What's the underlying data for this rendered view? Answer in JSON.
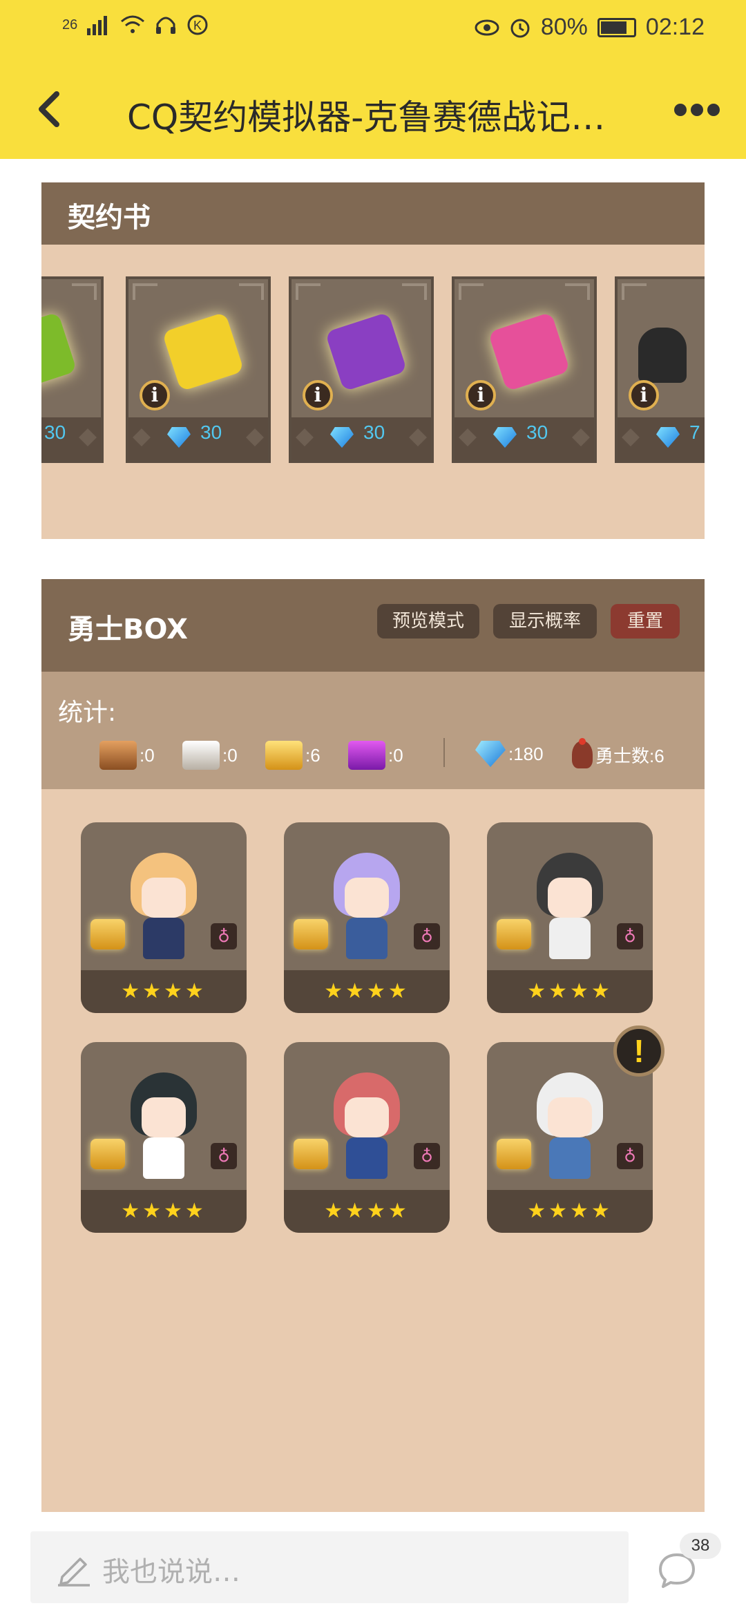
{
  "status_bar": {
    "signal": "26",
    "battery": "80%",
    "time": "02:12"
  },
  "header": {
    "title": "CQ契约模拟器-克鲁赛德战记…"
  },
  "contract_panel": {
    "title": "契约书",
    "cards": [
      {
        "scroll_color": "#7dbb2a",
        "price": "30"
      },
      {
        "scroll_color": "#f2cf2a",
        "price": "30"
      },
      {
        "scroll_color": "#8a3fc2",
        "price": "30"
      },
      {
        "scroll_color": "#e6509a",
        "price": "30"
      },
      {
        "scroll_color": "hero",
        "price": "7"
      }
    ]
  },
  "box_panel": {
    "title": "勇士BOX",
    "buttons": {
      "preview": "预览模式",
      "probability": "显示概率",
      "reset": "重置"
    },
    "stats": {
      "label": "统计:",
      "bronze": ":0",
      "silver": ":0",
      "gold": ":6",
      "purple": ":0",
      "gems": ":180",
      "hero_count": "勇士数:6"
    },
    "heroes": [
      {
        "stars": "★★★★",
        "hair": "#f4c27e",
        "outfit": "#2c3a66"
      },
      {
        "stars": "★★★★",
        "hair": "#b7a6ef",
        "outfit": "#3a5d9c"
      },
      {
        "stars": "★★★★",
        "hair": "#3b3b3b",
        "outfit": "#efefef"
      },
      {
        "stars": "★★★★",
        "hair": "#2a3336",
        "outfit": "#ffffff"
      },
      {
        "stars": "★★★★",
        "hair": "#d86a6a",
        "outfit": "#2f4f96"
      },
      {
        "stars": "★★★★",
        "hair": "#eeeeee",
        "outfit": "#4a78b8"
      }
    ],
    "alert_symbol": "!"
  },
  "bottom_bar": {
    "placeholder": "我也说说…",
    "comment_count": "38"
  }
}
